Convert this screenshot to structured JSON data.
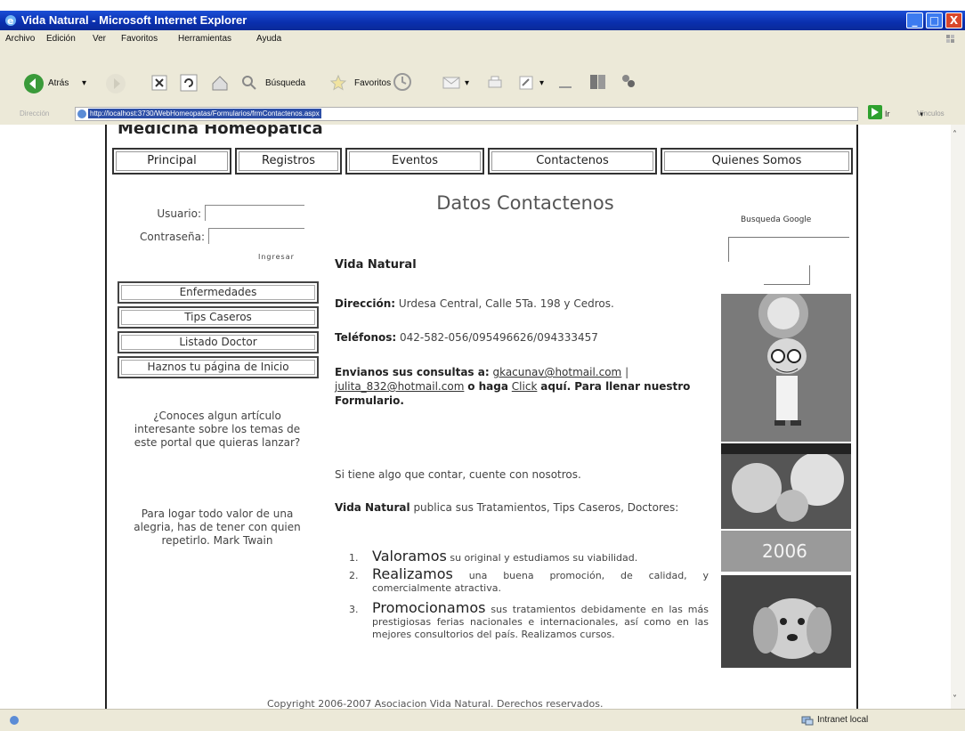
{
  "window": {
    "title": "Vida Natural - Microsoft Internet Explorer"
  },
  "menu": [
    "Archivo",
    "Edición",
    "Ver",
    "Favoritos",
    "Herramientas",
    "Ayuda"
  ],
  "toolbar": {
    "back": "Atrás",
    "search": "Búsqueda",
    "favorites": "Favoritos"
  },
  "address": {
    "label": "Dirección",
    "url": "http://localhost:3730/WebHomeopatas/Formularios/frmContactenos.aspx",
    "go": "Ir",
    "links": "Vínculos"
  },
  "status": {
    "zone": "Intranet local"
  },
  "site": {
    "title": "Medicina Homeopatica",
    "nav": [
      "Principal",
      "Registros",
      "Eventos",
      "Contactenos",
      "Quienes Somos"
    ],
    "login": {
      "user_label": "Usuario:",
      "password_label": "Contraseña:",
      "submit": "Ingresar"
    },
    "side_menu": [
      "Enfermedades",
      "Tips Caseros",
      "Listado Doctor",
      "Haznos tu página de Inicio"
    ],
    "side_question": "¿Conoces algun artículo interesante sobre los temas de este portal que quieras lanzar?",
    "side_quote": "Para logar todo valor de una alegria, has de tener con quien repetirlo. Mark Twain",
    "heading": "Datos Contactenos",
    "brand": "Vida Natural",
    "address_label": "Dirección:",
    "address_value": "Urdesa Central, Calle 5Ta. 198 y Cedros.",
    "phone_label": "Teléfonos:",
    "phone_value": "042-582-056/095496626/094333457",
    "consult_label": "Envianos sus consultas a:",
    "email1": "gkacunav@hotmail.com",
    "separator": "|",
    "email2": "julita_832@hotmail.com",
    "or_do": "o haga",
    "click": "Click",
    "consult_tail": "aquí. Para llenar nuestro Formulario.",
    "tell_us": "Si tiene algo que contar, cuente con nosotros.",
    "publishes_brand": "Vida Natural",
    "publishes_text": "publica sus Tratamientos, Tips Caseros, Doctores:",
    "list": [
      {
        "num": "1.",
        "lead": "Valoramos",
        "text": "su original y estudiamos su viabilidad."
      },
      {
        "num": "2.",
        "lead": "Realizamos",
        "text": "una buena promoción, de calidad, y comercialmente atractiva."
      },
      {
        "num": "3.",
        "lead": "Promocionamos",
        "text": "sus tratamientos debidamente en las más prestigiosas ferias nacionales e internacionales, así como en las mejores consultorios del país. Realizamos cursos."
      }
    ],
    "search_label": "Busqueda Google",
    "photo_year": "2006",
    "copyright": "Copyright 2006-2007 Asociacion Vida Natural. Derechos reservados."
  }
}
